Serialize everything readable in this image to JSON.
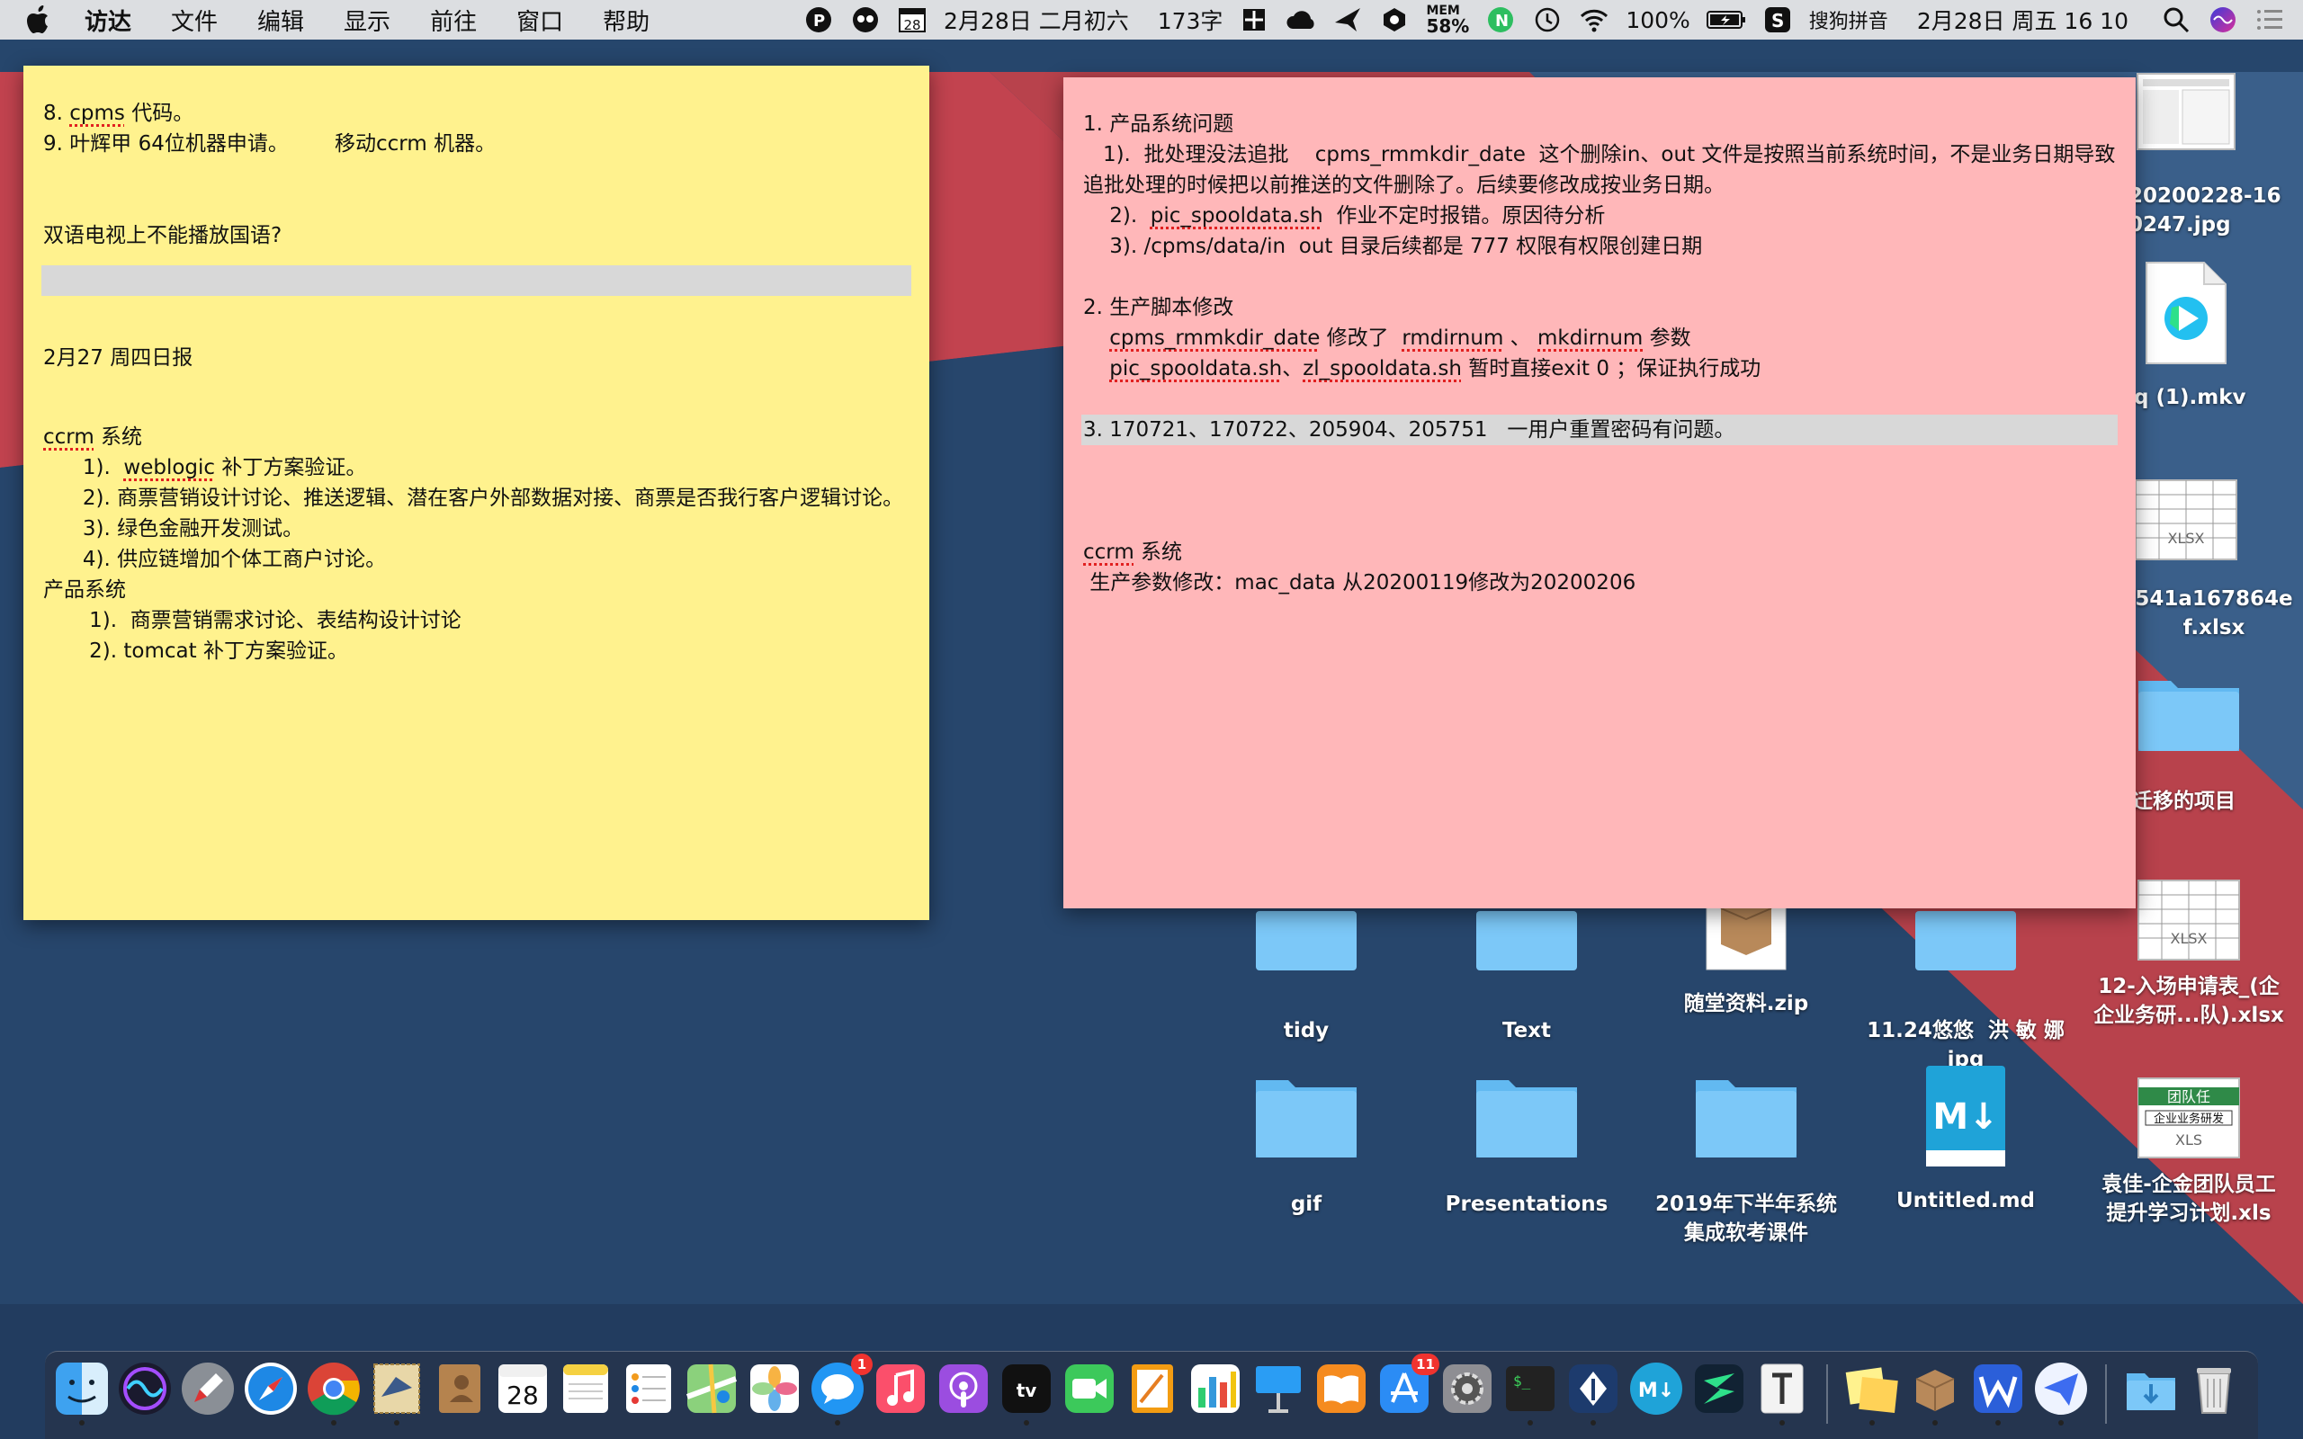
{
  "menubar": {
    "app_name": "访达",
    "menus": [
      "文件",
      "编辑",
      "显示",
      "前往",
      "窗口",
      "帮助"
    ],
    "calendar_day": "28",
    "date_lunar": "2月28日 二月初六",
    "word_count": "173字",
    "mem_label": "MEM",
    "mem_percent": "58%",
    "battery": "100%",
    "input_method": "搜狗拼音",
    "datetime": "2月28日 周五 16 10"
  },
  "yellow_note": {
    "lines": [
      "8. cpms 代码。",
      "9. 叶辉甲 64位机器申请。       移动ccrm 机器。",
      "",
      "",
      "双语电视上不能播放国语?",
      "",
      "",
      "",
      "",
      "2月27 周四日报",
      "",
      "",
      "ccrm 系统",
      "      1).  weblogic 补丁方案验证。",
      "      2). 商票营销设计讨论、推送逻辑、潜在客户外部数据对接、商票是否我行客户逻辑讨论。",
      "      3). 绿色金融开发测试。",
      "      4). 供应链增加个体工商户讨论。",
      "产品系统",
      "       1).  商票营销需求讨论、表结构设计讨论",
      "       2). tomcat 补丁方案验证。"
    ]
  },
  "pink_note": {
    "lines": [
      "1. 产品系统问题",
      "   1).  批处理没法追批    cpms_rmmkdir_date  这个删除in、out 文件是按照当前系统时间，不是业务日期导致追批处理的时候把以前推送的文件删除了。后续要修改成按业务日期。",
      "    2).  pic_spooldata.sh  作业不定时报错。原因待分析",
      "    3). /cpms/data/in  out 目录后续都是 777 权限有权限创建日期",
      "",
      "2. 生产脚本修改",
      "    cpms_rmmkdir_date 修改了  rmdirnum 、 mkdirnum 参数",
      "    pic_spooldata.sh、zl_spooldata.sh 暂时直接exit 0 ；保证执行成功",
      "",
      "3. 170721、170722、205904、205751   一用户重置密码有问题。",
      "",
      "",
      "",
      "ccrm 系统",
      " 生产参数修改：mac_data 从20200119修改为20200206"
    ]
  },
  "desktop_icons": [
    {
      "label": "tidy"
    },
    {
      "label": "Text"
    },
    {
      "label": "随堂资料.zip"
    },
    {
      "label": "11.24悠悠  洪 敏 娜\njpg"
    },
    {
      "label": "12-入场申请表_(企\n企业务研...队).xlsx"
    },
    {
      "label": "gif"
    },
    {
      "label": "Presentations"
    },
    {
      "label": "2019年下半年系统\n集成软考课件"
    },
    {
      "label": "Untitled.md"
    },
    {
      "label": "袁佳-企金团队员工\n提升学习计划.xls"
    },
    {
      "label": "20200228-16\n0247.jpg"
    },
    {
      "label": "q (1).mkv"
    },
    {
      "label": "541a167864e\nf.xlsx"
    },
    {
      "label": "迁移的项目"
    }
  ],
  "icon_text": {
    "md_glyph": "M↓",
    "xlsx_tag": "XLSX",
    "xls_tag": "XLS",
    "sheet_title": "团队任",
    "sheet_sub": "企业业务研发"
  },
  "dock": {
    "calendar_day": "28",
    "messages_badge": "1",
    "appstore_badge": "11",
    "appletv_label": "tv",
    "terminal_prompt": "$_"
  }
}
